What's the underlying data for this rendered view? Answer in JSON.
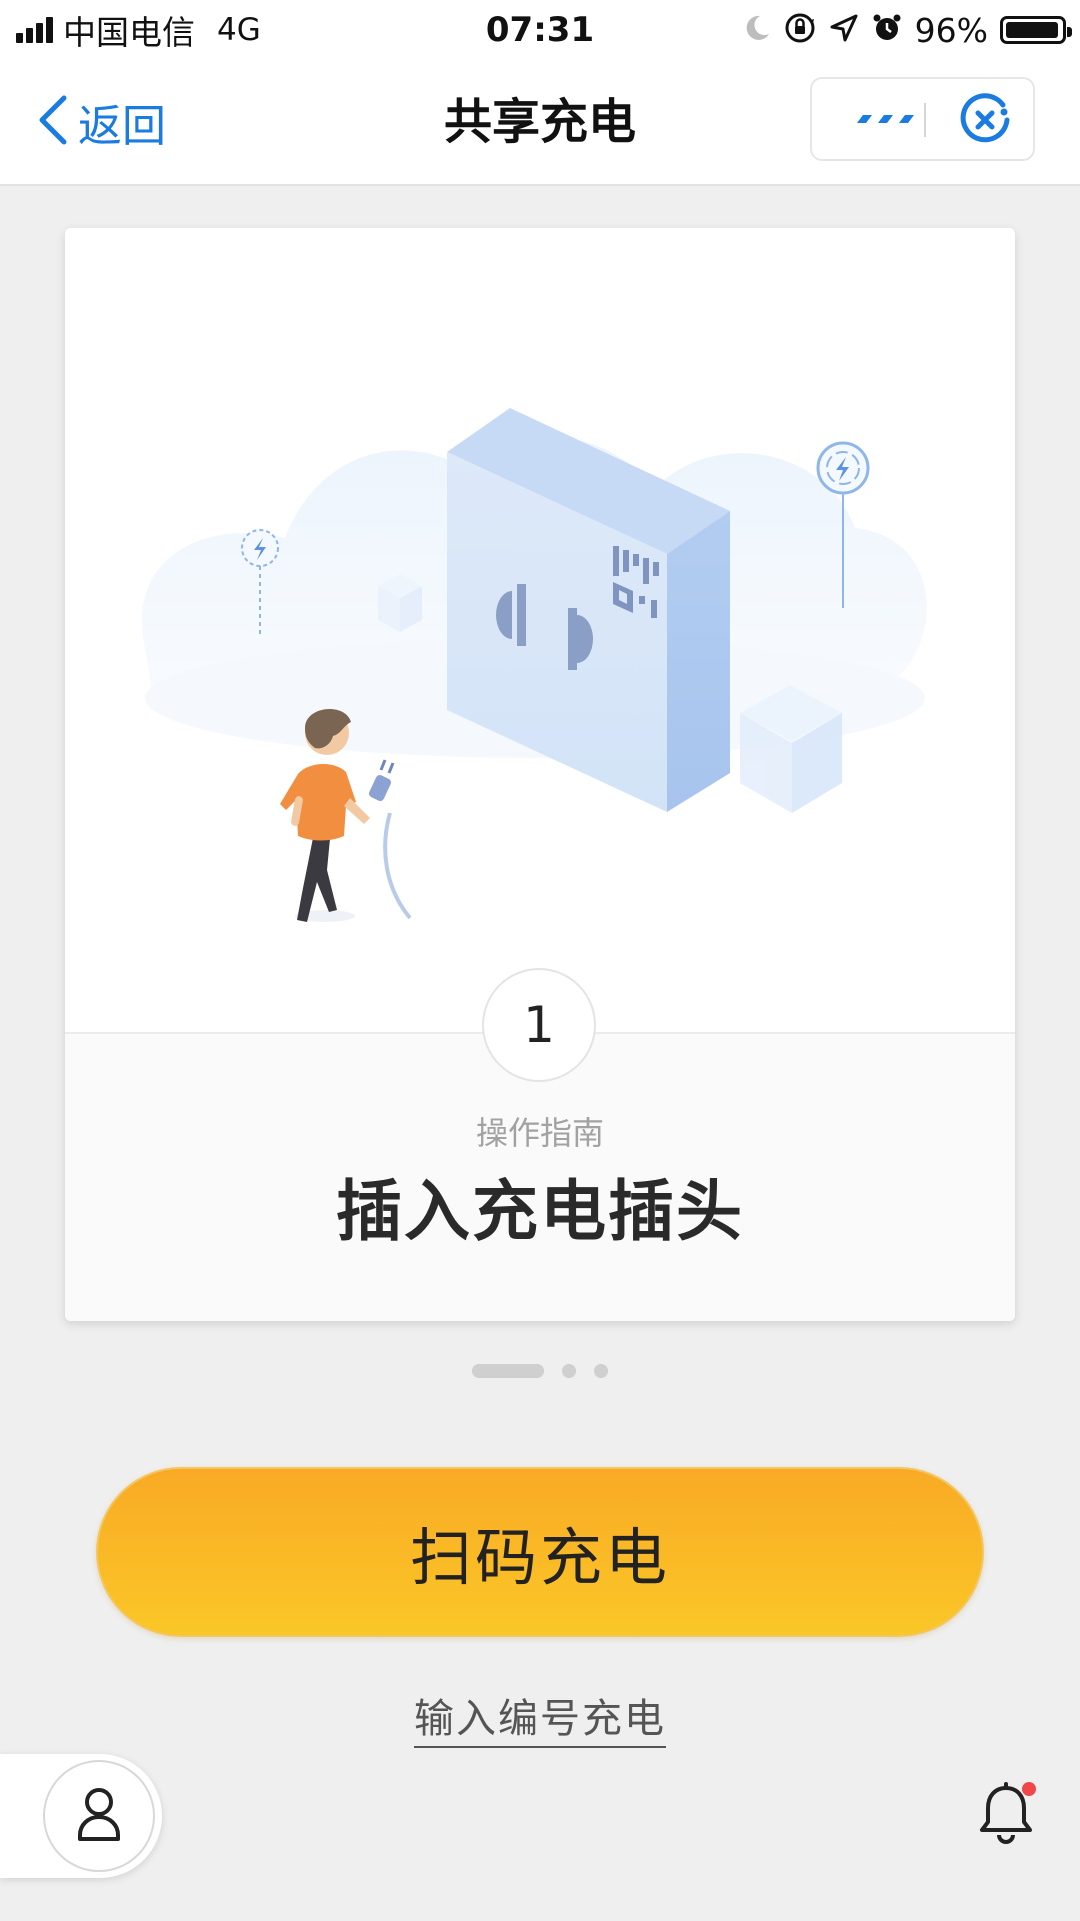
{
  "status_bar": {
    "carrier": "中国电信",
    "network": "4G",
    "time": "07:31",
    "battery_percent": "96%",
    "battery_level": 0.96,
    "icons": [
      "signal-icon",
      "moon-icon",
      "rotation-lock-icon",
      "location-arrow-icon",
      "alarm-icon",
      "battery-icon"
    ]
  },
  "nav": {
    "back_label": "返回",
    "title": "共享充电",
    "icons": [
      "chevron-left-icon",
      "more-icon",
      "close-circle-icon"
    ]
  },
  "card": {
    "step_number": "1",
    "guide_label": "操作指南",
    "step_title": "插入充电插头"
  },
  "pager": {
    "total": 3,
    "active": 0
  },
  "actions": {
    "scan_label": "扫码充电",
    "input_link_label": "输入编号充电"
  },
  "bottom": {
    "icons": [
      "user-icon",
      "bell-icon"
    ],
    "has_notification": true
  },
  "colors": {
    "accent_blue": "#1a7be0",
    "button_top": "#f9aa25",
    "button_bottom": "#fac727",
    "notification_dot": "#f04848"
  }
}
